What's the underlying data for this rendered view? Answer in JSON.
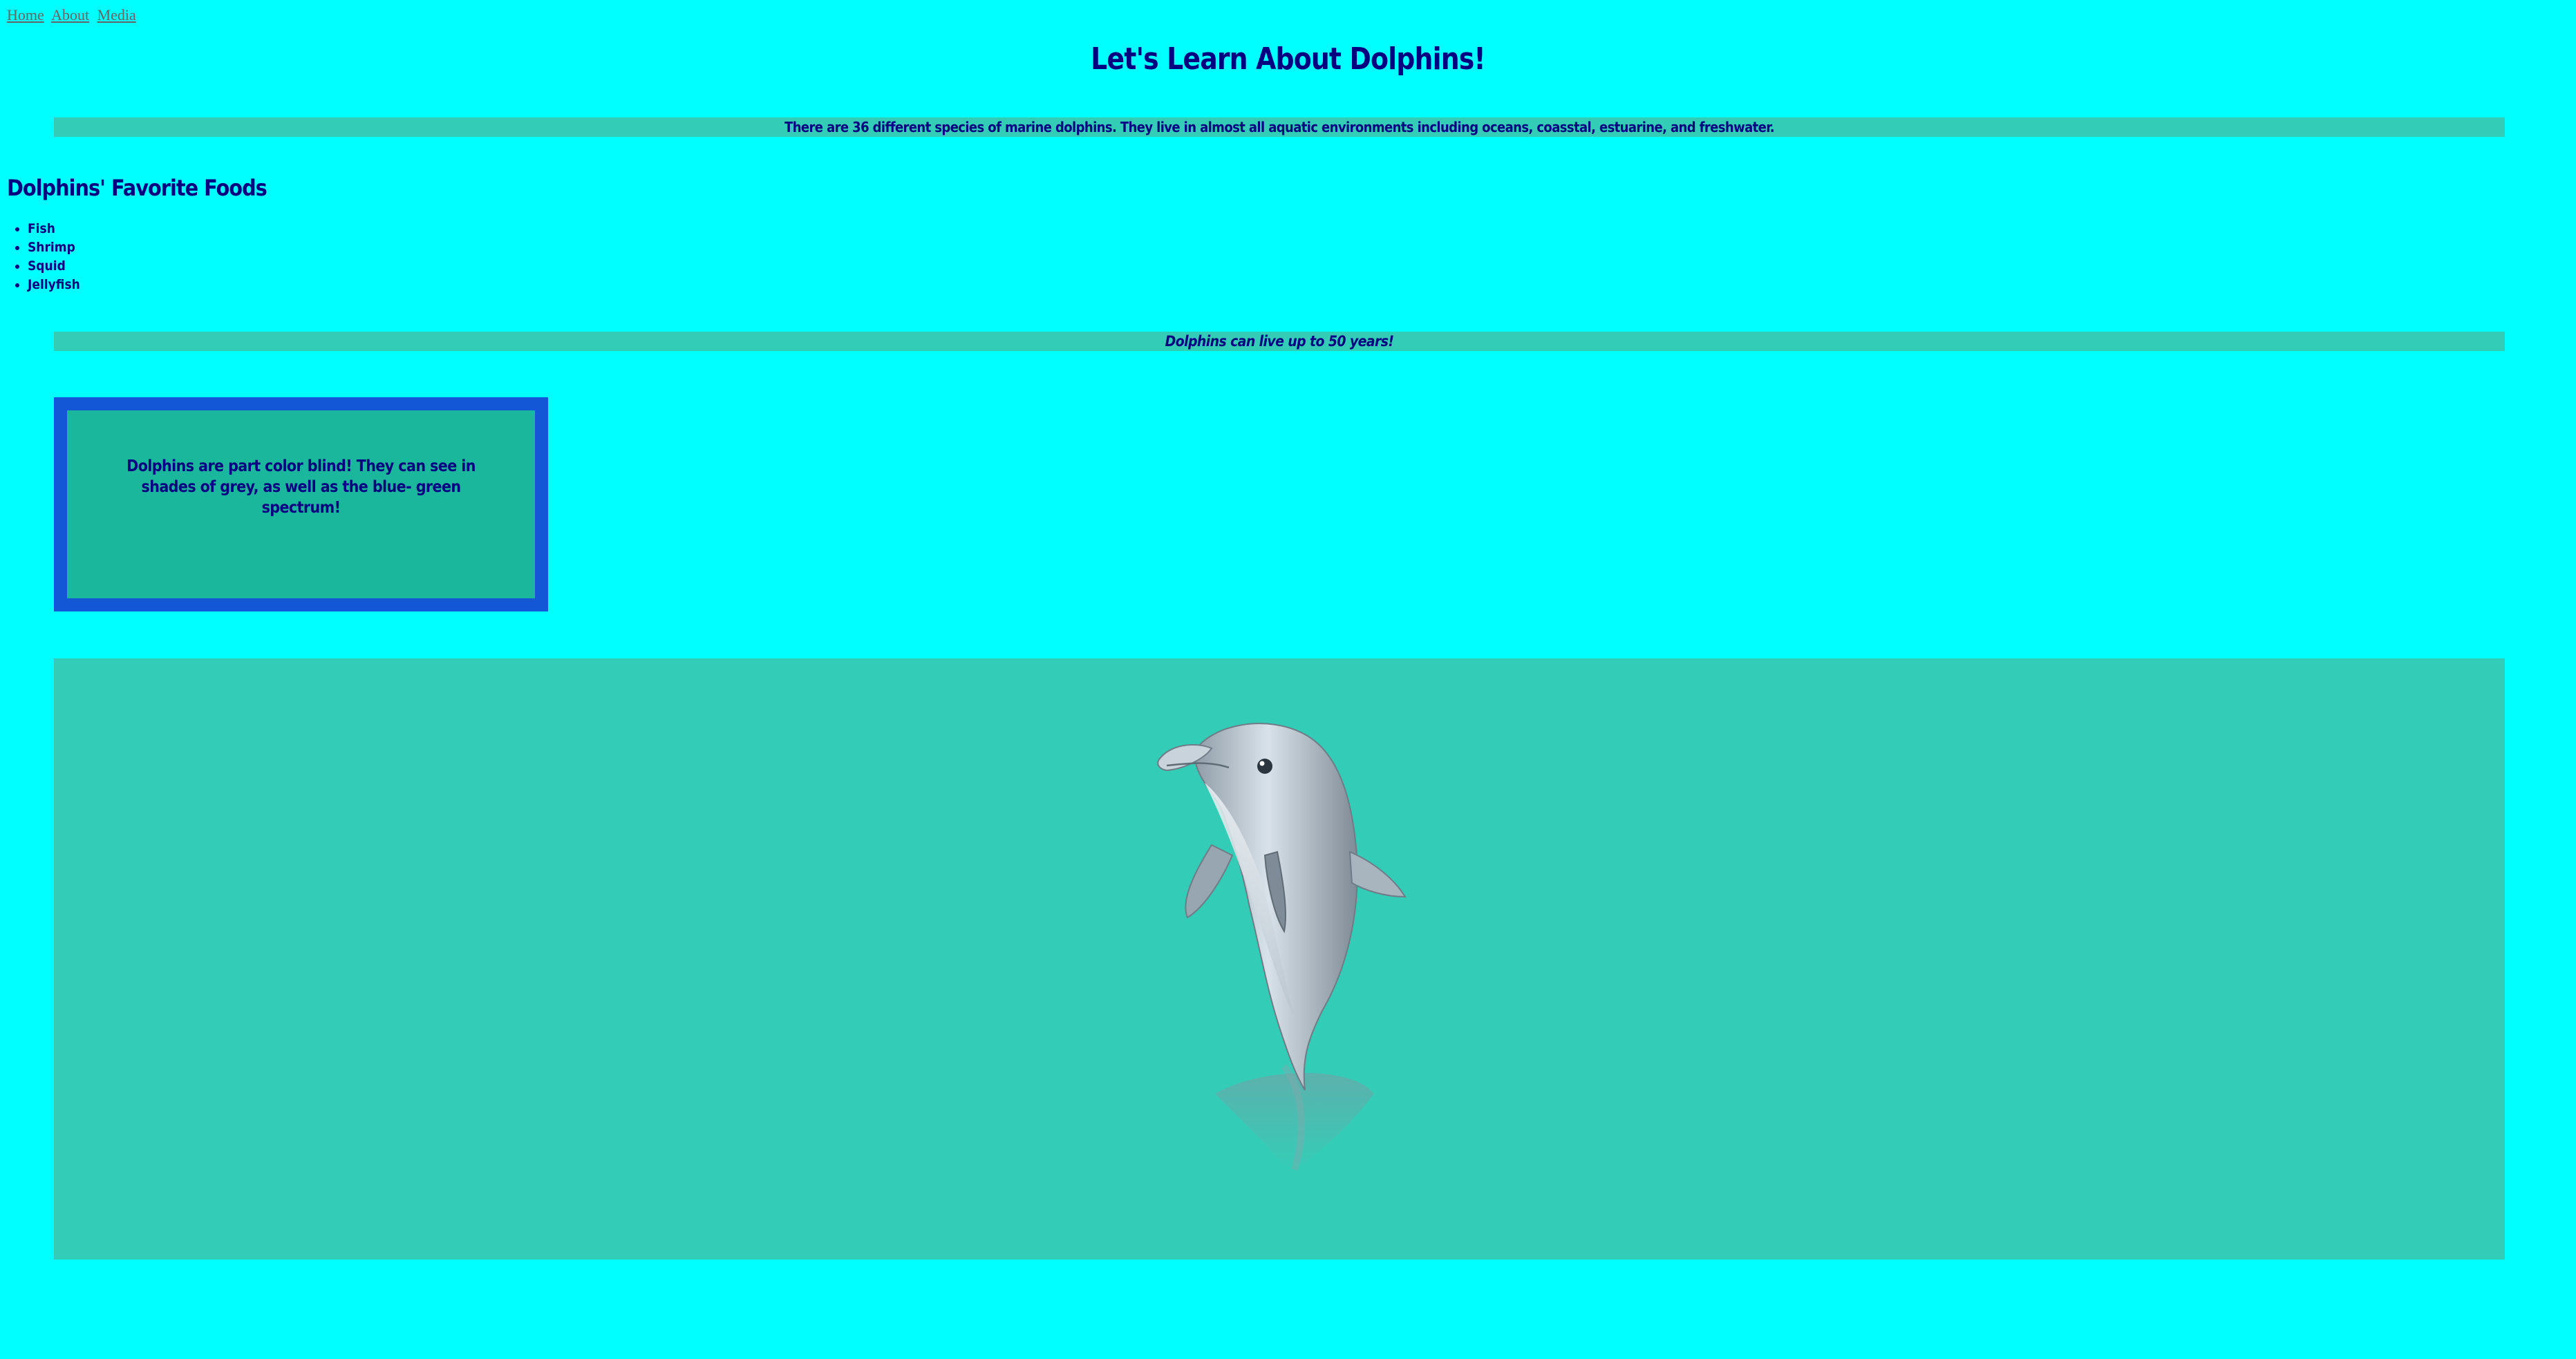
{
  "nav": {
    "links": [
      "Home",
      "About",
      "Media"
    ]
  },
  "header": {
    "title": "Let's Learn About Dolphins!"
  },
  "intro": {
    "text": "There are 36 different species of marine dolphins. They live in almost all aquatic environments including oceans, coasstal, estuarine, and freshwater."
  },
  "foods": {
    "title": "Dolphins' Favorite Foods",
    "items": [
      "Fish",
      "Shrimp",
      "Squid",
      "Jellyfish"
    ]
  },
  "lifespan": {
    "text": "Dolphins can live up to 50 years!"
  },
  "fact": {
    "text": "Dolphins are part color blind! They can see in shades of grey, as well as the blue- green spectrum!"
  },
  "colors": {
    "page_background": "#00ffff",
    "band": "#33cdb7",
    "box_border": "#1457d6",
    "box_fill": "#1ab79d",
    "text": "#000080",
    "link": "#666666"
  },
  "image": {
    "icon": "dolphin-illustration"
  }
}
